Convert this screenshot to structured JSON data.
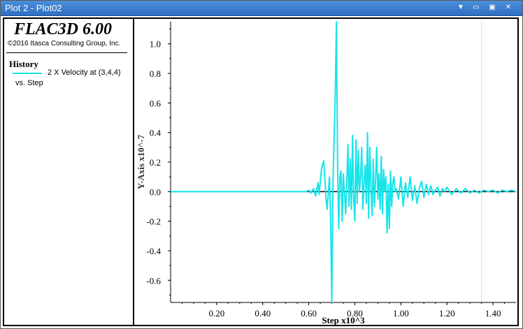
{
  "window": {
    "title": "Plot 2 - Plot02",
    "buttons": [
      "dropdown",
      "minimize",
      "restore",
      "close"
    ]
  },
  "legend": {
    "product": "FLAC3D 6.00",
    "copyright": "©2016 Itasca Consulting Group, Inc.",
    "history_title": "History",
    "series_label": "2 X Velocity at (3,4,4)",
    "series_sub": "vs. Step",
    "series_color": "#16e5ea"
  },
  "chart_data": {
    "type": "line",
    "xlabel": "Step x10^3",
    "ylabel": "Y-Axis x10^-7",
    "xlim": [
      0.0,
      1.5
    ],
    "ylim": [
      -0.75,
      1.15
    ],
    "xticks": [
      "0.20",
      "0.40",
      "0.60",
      "0.80",
      "1.00",
      "1.20",
      "1.40"
    ],
    "xtick_values": [
      0.2,
      0.4,
      0.6,
      0.8,
      1.0,
      1.2,
      1.4
    ],
    "yticks": [
      "-0.6",
      "-0.4",
      "-0.2",
      "0.0",
      "0.2",
      "0.4",
      "0.6",
      "0.8",
      "1.0"
    ],
    "ytick_values": [
      -0.6,
      -0.4,
      -0.2,
      0.0,
      0.2,
      0.4,
      0.6,
      0.8,
      1.0
    ],
    "zero_line": true,
    "series": [
      {
        "color": "#16e5ea",
        "x": [
          0.0,
          0.59,
          0.6,
          0.61,
          0.62,
          0.63,
          0.64,
          0.645,
          0.655,
          0.665,
          0.675,
          0.68,
          0.69,
          0.695,
          0.7,
          0.705,
          0.71,
          0.715,
          0.72,
          0.725,
          0.73,
          0.735,
          0.74,
          0.745,
          0.75,
          0.755,
          0.76,
          0.765,
          0.77,
          0.775,
          0.78,
          0.785,
          0.79,
          0.795,
          0.8,
          0.805,
          0.81,
          0.815,
          0.82,
          0.825,
          0.83,
          0.835,
          0.84,
          0.845,
          0.85,
          0.855,
          0.86,
          0.865,
          0.87,
          0.875,
          0.88,
          0.885,
          0.89,
          0.895,
          0.9,
          0.905,
          0.91,
          0.915,
          0.92,
          0.925,
          0.93,
          0.935,
          0.94,
          0.945,
          0.95,
          0.955,
          0.96,
          0.965,
          0.97,
          0.975,
          0.98,
          0.99,
          1.0,
          1.01,
          1.02,
          1.03,
          1.04,
          1.05,
          1.06,
          1.07,
          1.08,
          1.09,
          1.1,
          1.11,
          1.12,
          1.13,
          1.14,
          1.15,
          1.16,
          1.17,
          1.18,
          1.19,
          1.2,
          1.22,
          1.24,
          1.26,
          1.28,
          1.3,
          1.32,
          1.34,
          1.36,
          1.38,
          1.4,
          1.42,
          1.44,
          1.46,
          1.48,
          1.5
        ],
        "y": [
          0.0,
          0.0,
          0.01,
          -0.01,
          0.02,
          -0.03,
          0.06,
          -0.02,
          0.15,
          0.21,
          -0.05,
          -0.12,
          0.1,
          -0.18,
          -0.75,
          0.05,
          0.35,
          0.65,
          1.15,
          0.2,
          -0.25,
          0.1,
          0.14,
          -0.2,
          0.12,
          0.0,
          -0.15,
          0.05,
          0.32,
          -0.1,
          0.22,
          -0.12,
          0.38,
          -0.05,
          -0.2,
          0.35,
          -0.08,
          0.28,
          0.0,
          0.1,
          0.3,
          -0.12,
          0.05,
          0.18,
          -0.08,
          0.4,
          -0.18,
          0.3,
          0.04,
          -0.16,
          0.22,
          -0.1,
          0.08,
          0.3,
          -0.05,
          0.12,
          -0.12,
          0.24,
          -0.15,
          0.15,
          0.0,
          0.1,
          -0.28,
          0.05,
          -0.25,
          0.14,
          -0.1,
          0.06,
          0.1,
          0.0,
          0.02,
          -0.05,
          0.1,
          -0.1,
          0.06,
          -0.04,
          0.1,
          -0.06,
          0.04,
          -0.08,
          0.02,
          0.07,
          -0.04,
          0.05,
          -0.02,
          0.04,
          -0.02,
          0.01,
          0.03,
          -0.03,
          0.02,
          0.0,
          0.03,
          -0.02,
          0.02,
          -0.01,
          0.02,
          -0.01,
          0.01,
          -0.01,
          0.01,
          0.0,
          0.01,
          -0.01,
          0.01,
          0.0,
          0.01,
          0.0
        ]
      }
    ]
  }
}
